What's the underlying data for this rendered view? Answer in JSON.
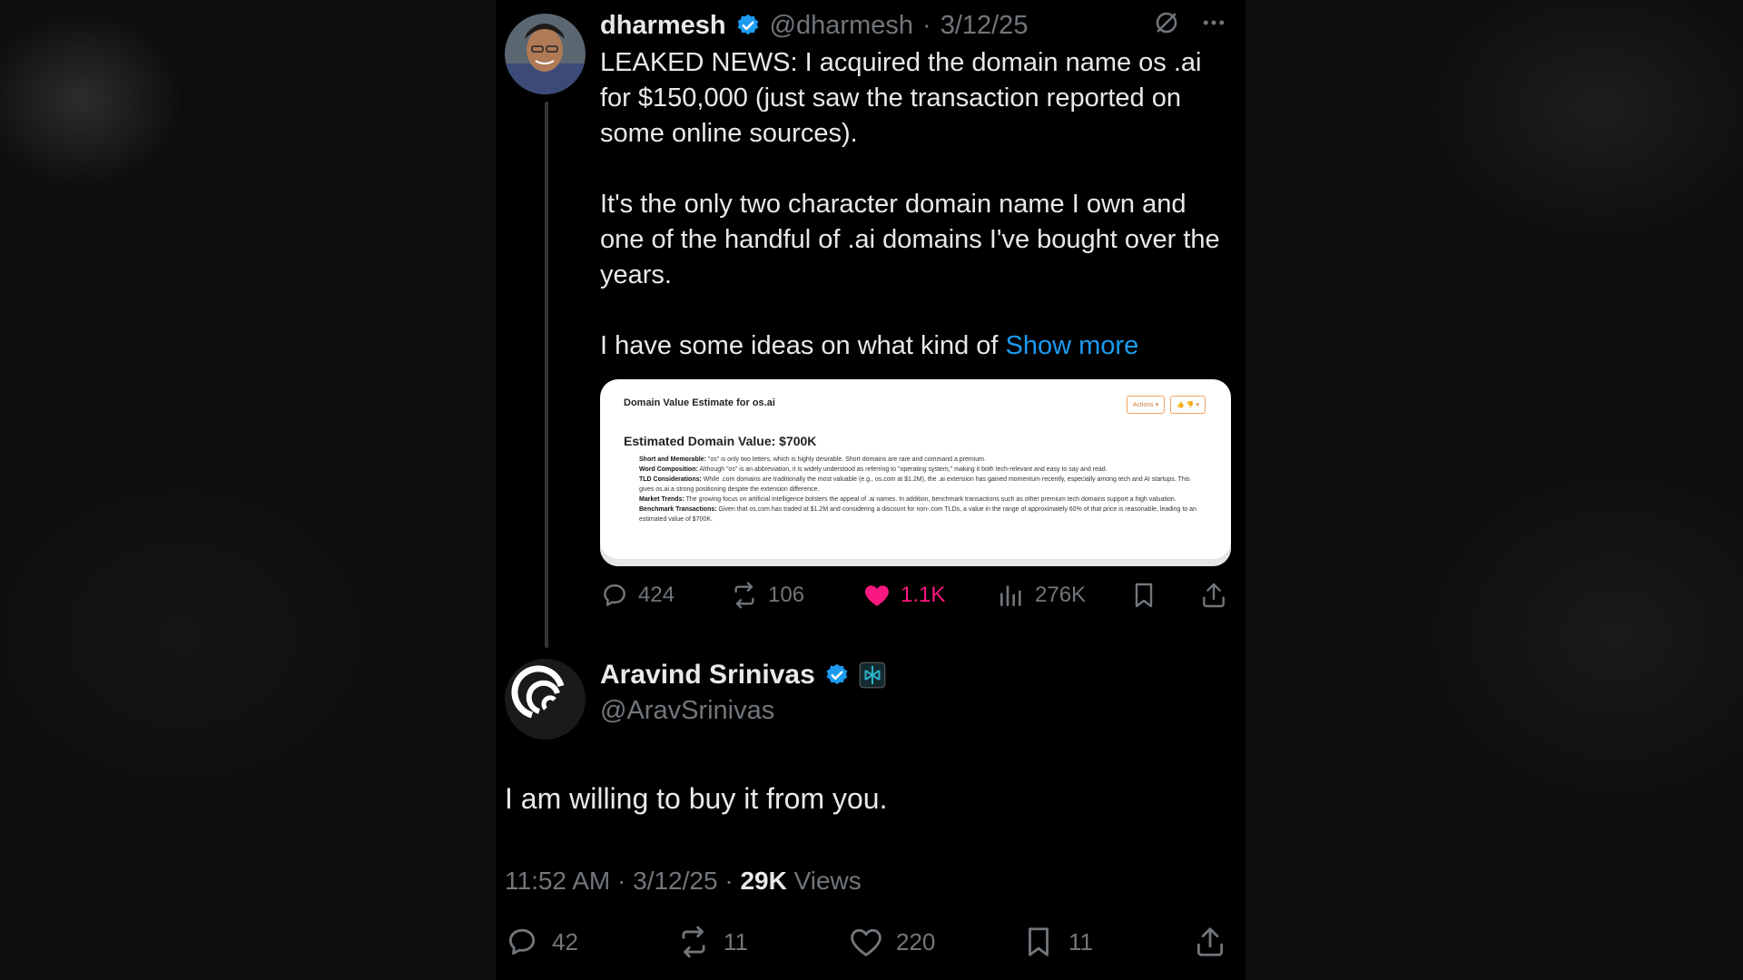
{
  "tweet": {
    "author_name": "dharmesh",
    "handle": "@dharmesh",
    "date": "3/12/25",
    "text_lines": [
      "LEAKED NEWS: I acquired the domain name os .ai for $150,000 (just saw the transaction reported on some online sources).",
      "It's the only two character domain name I own and one of the handful of .ai domains I've bought over the years.",
      "I have some ideas on what kind of "
    ],
    "show_more": "Show more",
    "media": {
      "title": "Domain Value Estimate for os.ai",
      "actions_label": "Actions",
      "heading": "Estimated Domain Value: $700K",
      "items": [
        {
          "label": "Short and Memorable:",
          "text": " \"os\" is only two letters, which is highly desirable. Short domains are rare and command a premium."
        },
        {
          "label": "Word Composition:",
          "text": " Although \"os\" is an abbreviation, it is widely understood as referring to \"operating system,\" making it both tech-relevant and easy to say and read."
        },
        {
          "label": "TLD Considerations:",
          "text": " While .com domains are traditionally the most valuable (e.g., os.com at $1.2M), the .ai extension has gained momentum recently, especially among tech and AI startups. This gives os.ai a strong positioning despite the extension difference."
        },
        {
          "label": "Market Trends:",
          "text": " The growing focus on artificial intelligence bolsters the appeal of .ai names. In addition, benchmark transactions such as other premium tech domains support a high valuation."
        },
        {
          "label": "Benchmark Transactions:",
          "text": " Given that os.com has traded at $1.2M and considering a discount for non-.com TLDs, a value in the range of approximately 60% of that price is reasonable, leading to an estimated value of $700K."
        }
      ]
    },
    "stats": {
      "replies": "424",
      "reposts": "106",
      "likes": "1.1K",
      "views": "276K"
    },
    "colors": {
      "like_active": "#f91880",
      "link": "#1d9bf0",
      "verified": "#1d9bf0"
    }
  },
  "reply": {
    "author_name": "Aravind Srinivas",
    "handle": "@AravSrinivas",
    "text": "I am willing to buy it from you.",
    "time": "11:52 AM",
    "date": "3/12/25",
    "views_count": "29K",
    "views_label": "Views",
    "stats": {
      "replies": "42",
      "reposts": "11",
      "likes": "220",
      "bookmarks": "11"
    }
  }
}
